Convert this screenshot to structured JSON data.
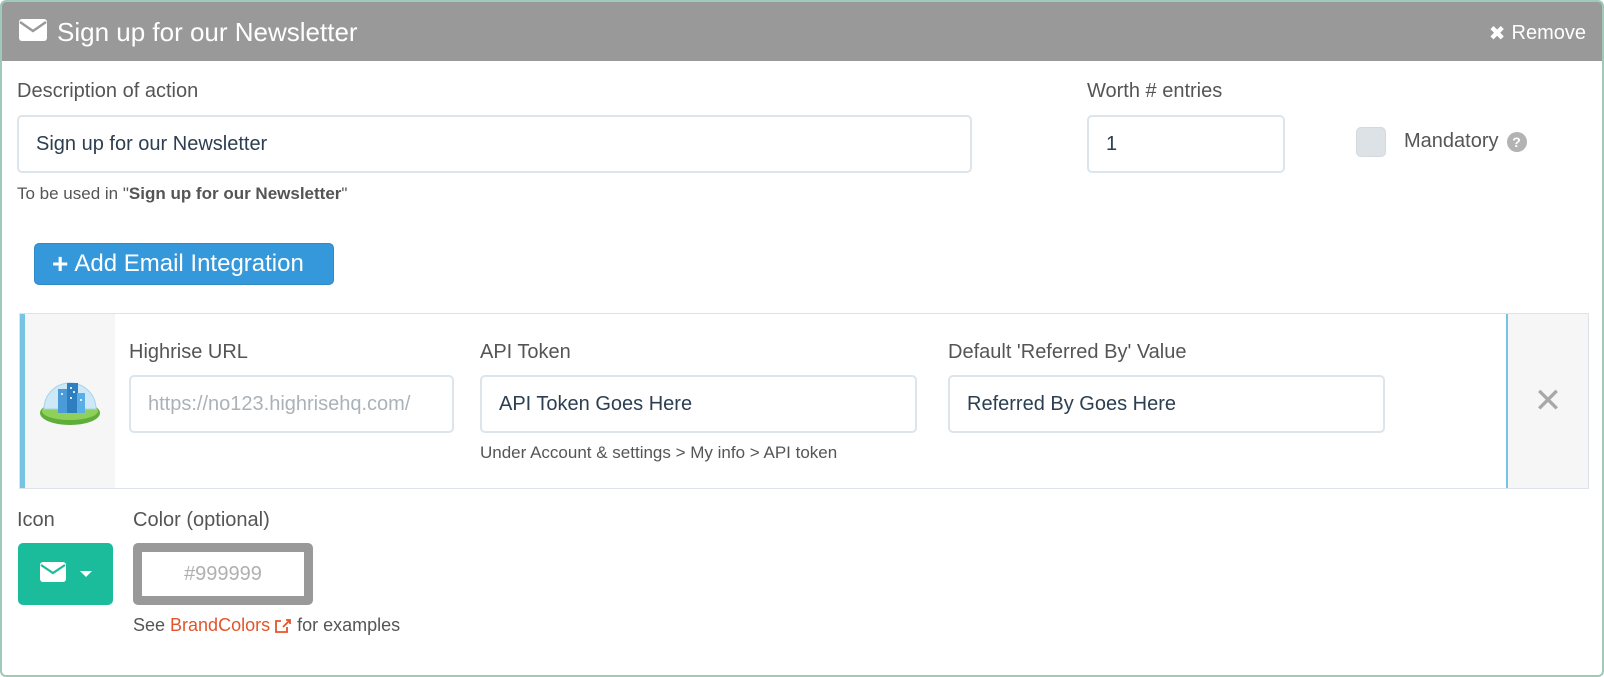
{
  "header": {
    "title": "Sign up for our Newsletter",
    "remove_label": "Remove",
    "icon": "envelope-icon",
    "remove_icon": "close-icon"
  },
  "action": {
    "description_label": "Description of action",
    "description_value": "Sign up for our Newsletter",
    "usage_prefix": "To be used in \"",
    "usage_name": "Sign up for our Newsletter",
    "usage_suffix": "\"",
    "worth_label": "Worth # entries",
    "worth_value": "1",
    "mandatory_label": "Mandatory",
    "mandatory_checked": false,
    "help_icon": "question-circle-icon"
  },
  "add_integration": {
    "label": "Add Email Integration",
    "icon": "plus-icon"
  },
  "integration": {
    "logo": "highrise-logo-icon",
    "url_label": "Highrise URL",
    "url_placeholder": "https://no123.highrisehq.com/",
    "url_value": "",
    "token_label": "API Token",
    "token_value": "API Token Goes Here",
    "token_help": "Under Account & settings > My info > API token",
    "referred_label": "Default 'Referred By' Value",
    "referred_value": "Referred By Goes Here",
    "close_icon": "close-icon"
  },
  "appearance": {
    "icon_label": "Icon",
    "icon_value": "envelope-icon",
    "color_label": "Color (optional)",
    "color_placeholder": "#999999",
    "see_prefix": "See",
    "brand_link": "BrandColors",
    "see_suffix": "for examples"
  },
  "colors": {
    "header_bg": "#999999",
    "primary": "#3498db",
    "success": "#1abc9c",
    "link": "#e2552b",
    "accent_bar": "#76c3e3"
  }
}
